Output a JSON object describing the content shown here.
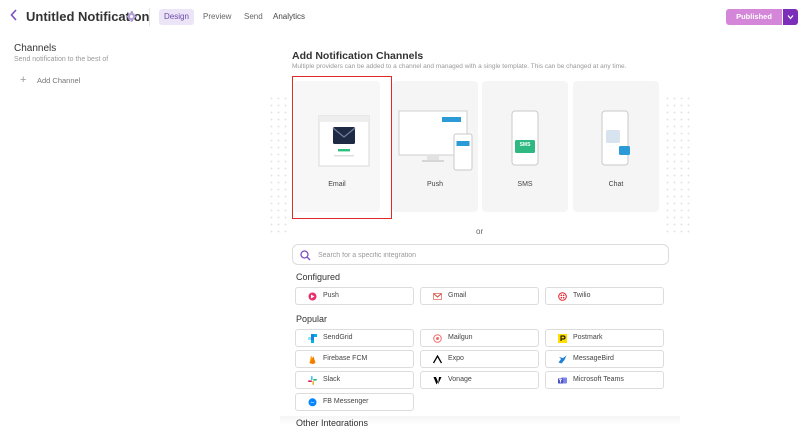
{
  "header": {
    "title": "Untitled Notification",
    "tabs": [
      {
        "label": "Design",
        "active": true
      },
      {
        "label": "Preview",
        "active": false
      },
      {
        "label": "Send",
        "active": false
      },
      {
        "label": "Analytics",
        "active": false
      }
    ],
    "publish_label": "Published",
    "colors": {
      "accent": "#7b2fb8",
      "publish_bg": "#d486d8",
      "active_tab_bg": "#ece4f7"
    }
  },
  "sidebar": {
    "title": "Channels",
    "subtitle": "Send notification to the best of",
    "add_label": "Add Channel"
  },
  "main": {
    "title": "Add Notification Channels",
    "subtitle": "Multiple providers can be added to a channel and managed with a single template. This can be changed at any time.",
    "channels": [
      {
        "label": "Email",
        "icon": "email-icon",
        "selected": true
      },
      {
        "label": "Push",
        "icon": "push-icon",
        "selected": false
      },
      {
        "label": "SMS",
        "icon": "sms-icon",
        "icon_text": "SMS",
        "selected": false
      },
      {
        "label": "Chat",
        "icon": "chat-icon",
        "selected": false
      }
    ],
    "or_text": "or",
    "search_placeholder": "Search for a specific integration",
    "sections": {
      "configured": "Configured",
      "popular": "Popular",
      "other": "Other Integrations"
    },
    "configured": [
      {
        "label": "Push",
        "icon": "push-logo-icon"
      },
      {
        "label": "Gmail",
        "icon": "gmail-icon"
      },
      {
        "label": "Twilio",
        "icon": "twilio-icon"
      }
    ],
    "popular": [
      {
        "label": "SendGrid",
        "icon": "sendgrid-icon"
      },
      {
        "label": "Mailgun",
        "icon": "mailgun-icon"
      },
      {
        "label": "Postmark",
        "icon": "postmark-icon"
      },
      {
        "label": "Firebase FCM",
        "icon": "firebase-icon"
      },
      {
        "label": "Expo",
        "icon": "expo-icon"
      },
      {
        "label": "MessageBird",
        "icon": "messagebird-icon"
      },
      {
        "label": "Slack",
        "icon": "slack-icon"
      },
      {
        "label": "Vonage",
        "icon": "vonage-icon"
      },
      {
        "label": "Microsoft Teams",
        "icon": "teams-icon"
      },
      {
        "label": "FB Messenger",
        "icon": "messenger-icon"
      }
    ]
  }
}
